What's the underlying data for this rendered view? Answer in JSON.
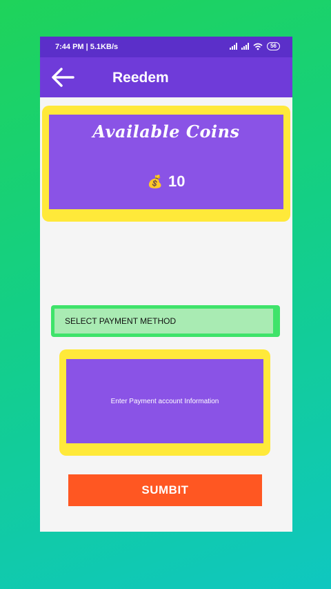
{
  "status_bar": {
    "time": "7:44 PM | 5.1KB/s",
    "battery": "56"
  },
  "app_bar": {
    "title": "Reedem"
  },
  "coins": {
    "title": "Available Coins",
    "value": "10",
    "icon": "money-bag-icon",
    "bag_glyph": "💰"
  },
  "payment": {
    "select_label": "SELECT PAYMENT METHOD",
    "account_placeholder": "Enter Payment account Information"
  },
  "actions": {
    "submit_label": "SUMBIT"
  },
  "colors": {
    "status_bar": "#5b2fc9",
    "app_bar": "#6f3bd9",
    "card_purple": "#8a53e6",
    "frame_yellow": "#ffe93a",
    "select_green": "#3fe36a",
    "submit_orange": "#ff5722"
  }
}
